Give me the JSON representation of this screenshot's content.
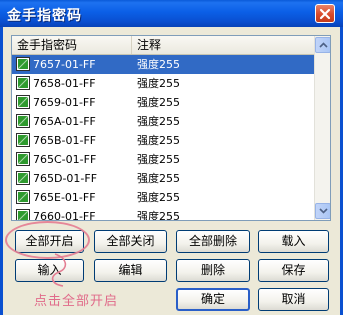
{
  "window": {
    "title": "金手指密码"
  },
  "list": {
    "headers": [
      "金手指密码",
      "注释"
    ],
    "rows": [
      {
        "code": "7657-01-FF",
        "note": "强度255",
        "checked": true,
        "selected": true
      },
      {
        "code": "7658-01-FF",
        "note": "强度255",
        "checked": true,
        "selected": false
      },
      {
        "code": "7659-01-FF",
        "note": "强度255",
        "checked": true,
        "selected": false
      },
      {
        "code": "765A-01-FF",
        "note": "强度255",
        "checked": true,
        "selected": false
      },
      {
        "code": "765B-01-FF",
        "note": "强度255",
        "checked": true,
        "selected": false
      },
      {
        "code": "765C-01-FF",
        "note": "强度255",
        "checked": true,
        "selected": false
      },
      {
        "code": "765D-01-FF",
        "note": "强度255",
        "checked": true,
        "selected": false
      },
      {
        "code": "765E-01-FF",
        "note": "强度255",
        "checked": true,
        "selected": false
      },
      {
        "code": "7660-01-FF",
        "note": "强度255",
        "checked": true,
        "selected": false
      }
    ]
  },
  "buttons": {
    "enable_all": "全部开启",
    "disable_all": "全部关闭",
    "delete_all": "全部删除",
    "load": "载入",
    "input": "输入",
    "edit": "编辑",
    "delete": "删除",
    "save": "保存",
    "ok": "确定",
    "cancel": "取消"
  },
  "annotation": {
    "hint": "点击全部开启"
  },
  "colors": {
    "titlebar": "#0a5ad8",
    "selection": "#316ac5",
    "annotation": "#e06b8a"
  }
}
